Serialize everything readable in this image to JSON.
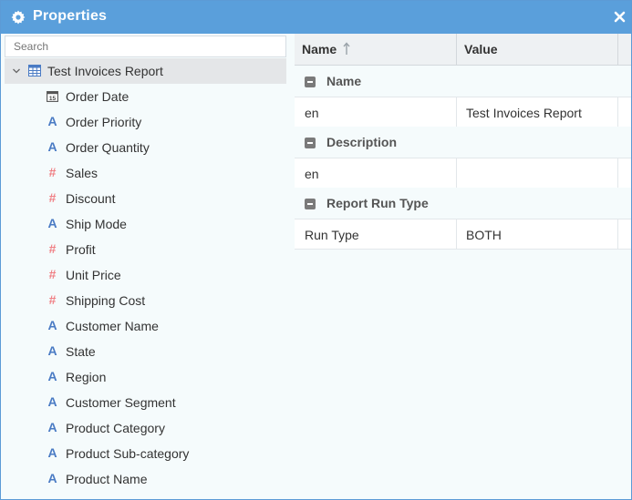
{
  "window": {
    "title": "Properties",
    "title_icon": "gear-icon",
    "close_icon": "close-icon"
  },
  "left_panel": {
    "search_placeholder": "Search",
    "root": {
      "label": "Test Invoices Report",
      "icon": "table-icon",
      "expanded": true
    },
    "fields": [
      {
        "label": "Order Date",
        "type": "date",
        "icon": "calendar-icon",
        "icon_glyph": "15"
      },
      {
        "label": "Order Priority",
        "type": "text",
        "icon": "text-type-icon",
        "icon_glyph": "A"
      },
      {
        "label": "Order Quantity",
        "type": "text",
        "icon": "text-type-icon",
        "icon_glyph": "A"
      },
      {
        "label": "Sales",
        "type": "number",
        "icon": "number-type-icon",
        "icon_glyph": "#"
      },
      {
        "label": "Discount",
        "type": "number",
        "icon": "number-type-icon",
        "icon_glyph": "#"
      },
      {
        "label": "Ship Mode",
        "type": "text",
        "icon": "text-type-icon",
        "icon_glyph": "A"
      },
      {
        "label": "Profit",
        "type": "number",
        "icon": "number-type-icon",
        "icon_glyph": "#"
      },
      {
        "label": "Unit Price",
        "type": "number",
        "icon": "number-type-icon",
        "icon_glyph": "#"
      },
      {
        "label": "Shipping Cost",
        "type": "number",
        "icon": "number-type-icon",
        "icon_glyph": "#"
      },
      {
        "label": "Customer Name",
        "type": "text",
        "icon": "text-type-icon",
        "icon_glyph": "A"
      },
      {
        "label": "State",
        "type": "text",
        "icon": "text-type-icon",
        "icon_glyph": "A"
      },
      {
        "label": "Region",
        "type": "text",
        "icon": "text-type-icon",
        "icon_glyph": "A"
      },
      {
        "label": "Customer Segment",
        "type": "text",
        "icon": "text-type-icon",
        "icon_glyph": "A"
      },
      {
        "label": "Product Category",
        "type": "text",
        "icon": "text-type-icon",
        "icon_glyph": "A"
      },
      {
        "label": "Product Sub-category",
        "type": "text",
        "icon": "text-type-icon",
        "icon_glyph": "A"
      },
      {
        "label": "Product Name",
        "type": "text",
        "icon": "text-type-icon",
        "icon_glyph": "A"
      }
    ]
  },
  "grid": {
    "columns": {
      "name": "Name",
      "value": "Value"
    },
    "sort_icon": "sort-ascending-icon",
    "groups": [
      {
        "label": "Name",
        "rows": [
          {
            "name": "en",
            "value": "Test Invoices Report"
          }
        ]
      },
      {
        "label": "Description",
        "rows": [
          {
            "name": "en",
            "value": ""
          }
        ]
      },
      {
        "label": "Report Run Type",
        "rows": [
          {
            "name": "Run Type",
            "value": "BOTH"
          }
        ]
      }
    ]
  },
  "colors": {
    "titlebar": "#5a9fdb",
    "text_type_icon": "#4a7bc4",
    "number_type_icon": "#f07f84",
    "selected_row": "#e4e6e8"
  }
}
